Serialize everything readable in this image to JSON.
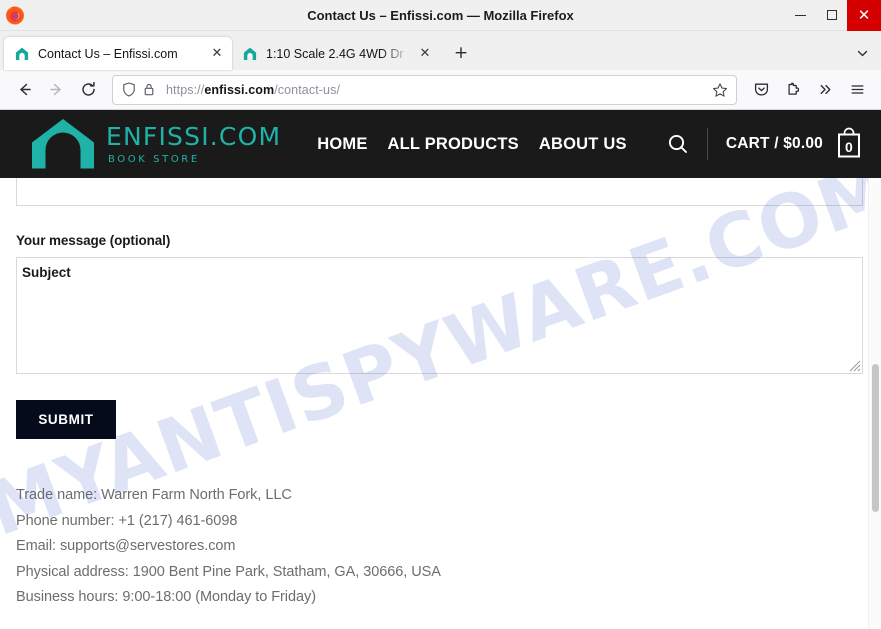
{
  "window": {
    "title": "Contact Us – Enfissi.com — Mozilla Firefox",
    "minimize_label": "—",
    "maximize_label": "",
    "close_label": "✕",
    "firefox_logo_icon": "firefox-logo-icon"
  },
  "tabs": {
    "items": [
      {
        "title": "Contact Us – Enfissi.com",
        "favicon": "enfissi-house-favicon",
        "active": true,
        "close_label": "✕"
      },
      {
        "title": "1:10 Scale 2.4G 4WD Dr",
        "favicon": "enfissi-house-favicon",
        "active": false,
        "close_label": "✕"
      }
    ],
    "new_tab_label": "+",
    "list_all_tabs_icon": "chevron-down-icon"
  },
  "toolbar": {
    "back_icon": "back-arrow-icon",
    "forward_icon": "forward-arrow-icon",
    "reload_icon": "reload-icon",
    "shield_icon": "shield-icon",
    "lock_icon": "lock-icon",
    "url_scheme": "https://",
    "url_host": "enfissi.com",
    "url_path": "/contact-us/",
    "bookmark_icon": "star-icon",
    "pocket_icon": "pocket-icon",
    "extensions_icon": "puzzle-piece-icon",
    "overflow_icon": "double-chevron-right-icon",
    "menu_icon": "hamburger-menu-icon"
  },
  "site_header": {
    "logo_icon": "house-keyhole-logo-icon",
    "logo_title": "ENFISSI.COM",
    "logo_subtitle": "BOOK STORE",
    "nav": [
      {
        "label": "HOME"
      },
      {
        "label": "ALL PRODUCTS"
      },
      {
        "label": "ABOUT US"
      }
    ],
    "search_icon": "search-icon",
    "cart_label": "CART / $0.00",
    "cart_icon": "shopping-bag-icon",
    "cart_count": "0",
    "bg_color": "#1a1a1a",
    "accent_color": "#1fb2a6"
  },
  "form": {
    "ghost_label": "Subject",
    "message_label": "Your message (optional)",
    "message_value": "",
    "message_placeholder": "",
    "submit_label": "SUBMIT",
    "submit_bg": "#050b1b"
  },
  "contact_info": {
    "lines": [
      "Trade name: Warren Farm North Fork, LLC",
      "Phone number: +1 (217) 461-6098",
      "Email: supports@servestores.com",
      "Physical address: 1900 Bent Pine Park, Statham, GA, 30666, USA",
      "Business hours: 9:00-18:00 (Monday to Friday)"
    ]
  },
  "watermark": {
    "text": "MYANTISPYWARE.COM",
    "color": "#3a5fcd"
  }
}
